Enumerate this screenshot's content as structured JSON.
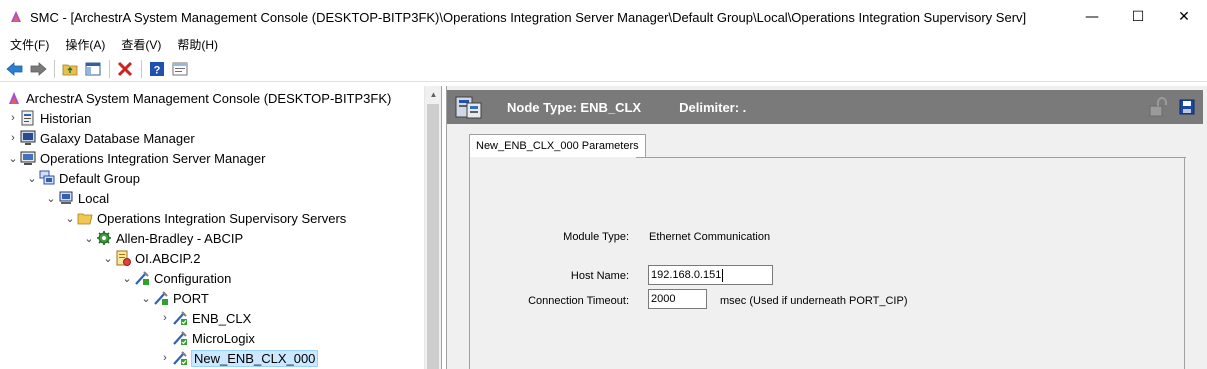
{
  "window": {
    "title": "SMC - [ArchestrA System Management Console (DESKTOP-BITP3FK)\\Operations Integration Server Manager\\Default Group\\Local\\Operations Integration Supervisory Serv]",
    "minimize": "—",
    "maximize": "☐",
    "close": "✕"
  },
  "menu": {
    "file": "文件(F)",
    "action": "操作(A)",
    "view": "查看(V)",
    "help": "帮助(H)"
  },
  "toolbar": {
    "icons": [
      "back-icon",
      "forward-icon",
      "up-folder-icon",
      "show-hide-tree-icon",
      "delete-icon",
      "help-icon",
      "properties-icon"
    ]
  },
  "tree": {
    "items": [
      {
        "label": "ArchestrA System Management Console (DESKTOP-BITP3FK)",
        "expander": "",
        "icon": "console-icon"
      },
      {
        "label": "Historian",
        "expander": "›",
        "icon": "historian-icon"
      },
      {
        "label": "Galaxy Database Manager",
        "expander": "›",
        "icon": "database-manager-icon"
      },
      {
        "label": "Operations Integration Server Manager",
        "expander": "⌄",
        "icon": "server-manager-icon"
      },
      {
        "label": "Default Group",
        "expander": "⌄",
        "icon": "group-icon"
      },
      {
        "label": "Local",
        "expander": "⌄",
        "icon": "computer-icon"
      },
      {
        "label": "Operations Integration Supervisory Servers",
        "expander": "⌄",
        "icon": "folder-icon"
      },
      {
        "label": "Allen-Bradley - ABCIP",
        "expander": "⌄",
        "icon": "gear-icon"
      },
      {
        "label": "OI.ABCIP.2",
        "expander": "⌄",
        "icon": "server-instance-icon"
      },
      {
        "label": "Configuration",
        "expander": "⌄",
        "icon": "config-icon"
      },
      {
        "label": "PORT",
        "expander": "⌄",
        "icon": "port-icon"
      },
      {
        "label": "ENB_CLX",
        "expander": "›",
        "icon": "node-icon"
      },
      {
        "label": "MicroLogix",
        "expander": "",
        "icon": "node-icon"
      },
      {
        "label": "New_ENB_CLX_000",
        "expander": "›",
        "icon": "node-icon"
      }
    ]
  },
  "header": {
    "node_type": "Node Type: ENB_CLX",
    "delimiter": "Delimiter:  ."
  },
  "tab": {
    "label": "New_ENB_CLX_000 Parameters"
  },
  "params": {
    "module_type_label": "Module Type:",
    "module_type_value": "Ethernet Communication",
    "host_name_label": "Host Name:",
    "host_name_value": "192.168.0.151",
    "timeout_label": "Connection Timeout:",
    "timeout_value": "2000",
    "timeout_unit": "msec   (Used if underneath PORT_CIP)"
  },
  "colors": {
    "header_bg": "#7a7a7a",
    "selection": "#cce8ff",
    "panel_bg": "#f0f0f0"
  }
}
